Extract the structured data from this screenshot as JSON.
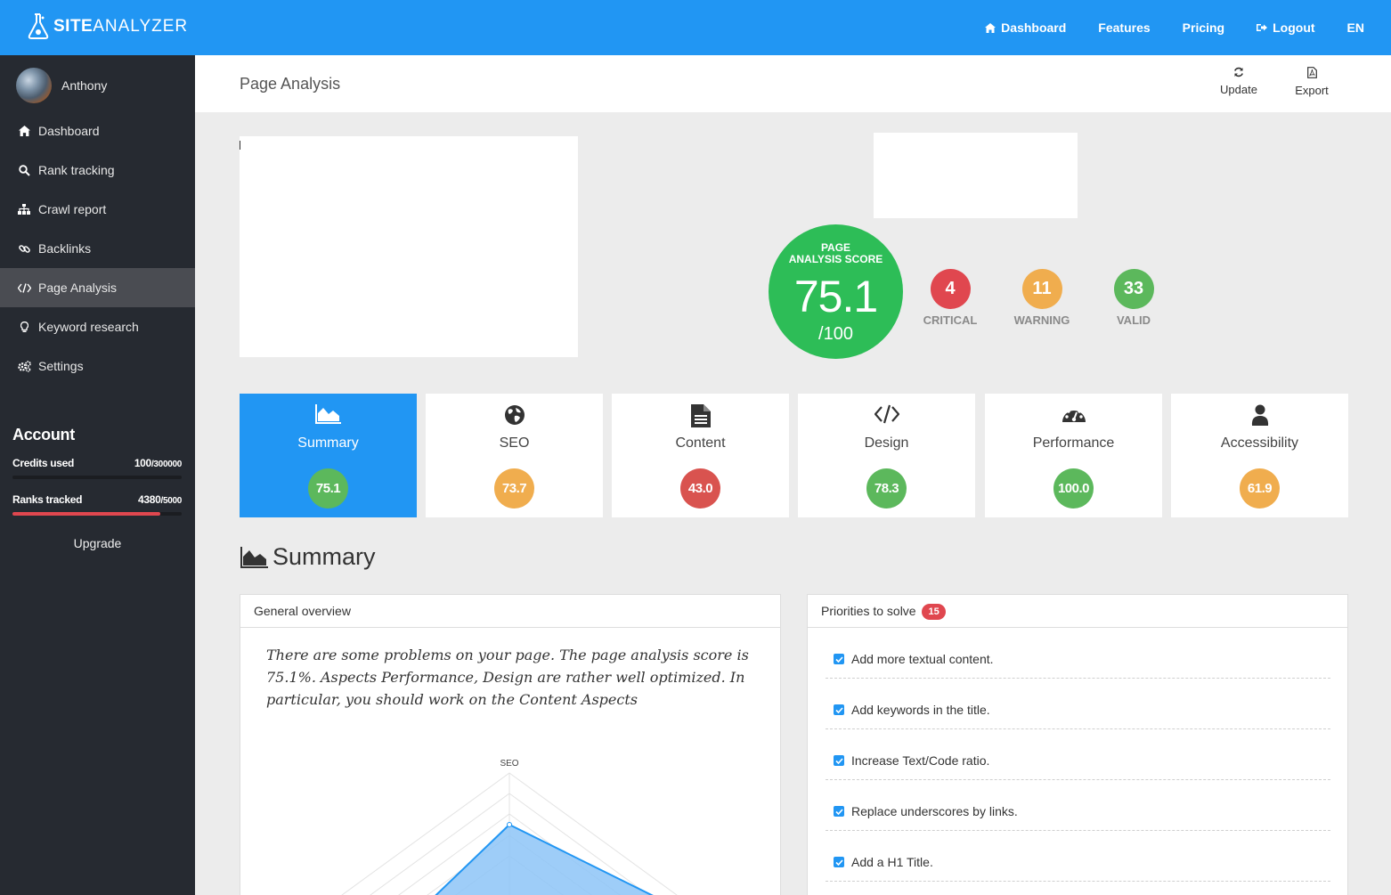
{
  "brand": {
    "name_bold": "SITE",
    "name_light": "ANALYZER"
  },
  "topnav": {
    "dashboard": "Dashboard",
    "features": "Features",
    "pricing": "Pricing",
    "logout": "Logout",
    "language": "EN"
  },
  "user": {
    "name": "Anthony"
  },
  "sidebar": {
    "items": [
      {
        "label": "Dashboard",
        "icon": "home-icon"
      },
      {
        "label": "Rank tracking",
        "icon": "search-icon"
      },
      {
        "label": "Crawl report",
        "icon": "sitemap-icon"
      },
      {
        "label": "Backlinks",
        "icon": "link-icon"
      },
      {
        "label": "Page Analysis",
        "icon": "code-icon",
        "active": true
      },
      {
        "label": "Keyword research",
        "icon": "lightbulb-icon"
      },
      {
        "label": "Settings",
        "icon": "gears-icon"
      }
    ]
  },
  "account": {
    "title": "Account",
    "credits": {
      "label": "Credits used",
      "used": "100",
      "total": "/300000",
      "fraction": 0.0003
    },
    "ranks": {
      "label": "Ranks tracked",
      "used": "4380",
      "total": "/5000",
      "fraction": 0.876
    },
    "upgrade": "Upgrade"
  },
  "page": {
    "title": "Page Analysis",
    "update": "Update",
    "export": "Export"
  },
  "score": {
    "label_line1": "PAGE",
    "label_line2": "ANALYSIS SCORE",
    "value": "75.1",
    "max": "/100",
    "critical": {
      "count": "4",
      "label": "CRITICAL"
    },
    "warning": {
      "count": "11",
      "label": "WARNING"
    },
    "valid": {
      "count": "33",
      "label": "VALID"
    }
  },
  "categories": [
    {
      "name": "Summary",
      "score": "75.1",
      "icon": "area-chart-icon",
      "color": "#5cb85c",
      "active": true
    },
    {
      "name": "SEO",
      "score": "73.7",
      "icon": "globe-icon",
      "color": "#f0ad4e"
    },
    {
      "name": "Content",
      "score": "43.0",
      "icon": "file-text-icon",
      "color": "#d9534f"
    },
    {
      "name": "Design",
      "score": "78.3",
      "icon": "code-icon",
      "color": "#5cb85c"
    },
    {
      "name": "Performance",
      "score": "100.0",
      "icon": "tachometer-icon",
      "color": "#5cb85c"
    },
    {
      "name": "Accessibility",
      "score": "61.9",
      "icon": "user-icon",
      "color": "#f0ad4e"
    }
  ],
  "summary": {
    "heading": "Summary",
    "overview": {
      "title": "General overview",
      "text": "There are some problems on your page. The page analysis score is 75.1%. Aspects Performance, Design are rather well optimized. In particular, you should work on the Content Aspects"
    },
    "radar": {
      "top_label": "SEO"
    },
    "priorities": {
      "title": "Priorities to solve",
      "count": "15",
      "items": [
        "Add more textual content.",
        "Add keywords in the title.",
        "Increase Text/Code ratio.",
        "Replace underscores by links.",
        "Add a H1 Title."
      ]
    }
  },
  "colors": {
    "primary": "#2196f3",
    "sidebar": "#262a31",
    "critical": "#e0474f",
    "warning": "#f0ad4e",
    "valid": "#5cb85c",
    "score": "#2dbd57"
  }
}
